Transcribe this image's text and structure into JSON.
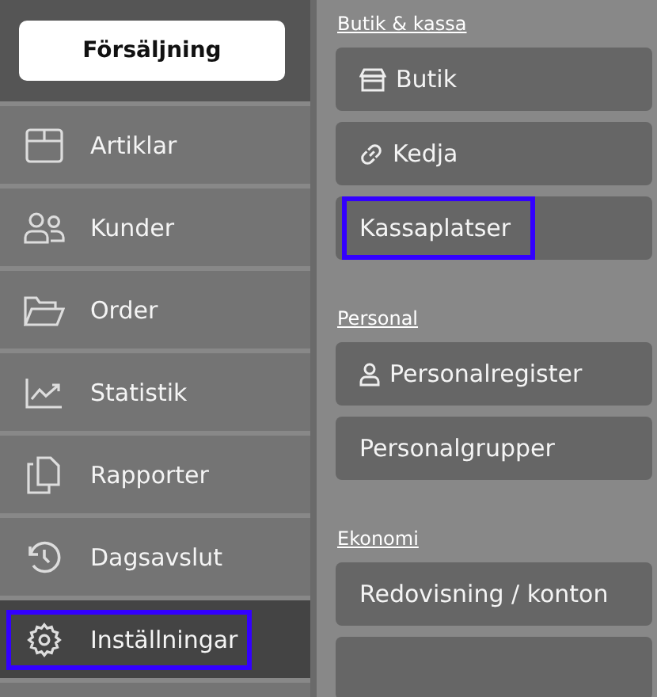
{
  "sales_button": {
    "label": "Försäljning"
  },
  "nav": [
    {
      "label": "Artiklar",
      "kind": "box",
      "selected": false,
      "highlighted": false
    },
    {
      "label": "Kunder",
      "kind": "users",
      "selected": false,
      "highlighted": false
    },
    {
      "label": "Order",
      "kind": "folder",
      "selected": false,
      "highlighted": false
    },
    {
      "label": "Statistik",
      "kind": "chart",
      "selected": false,
      "highlighted": false
    },
    {
      "label": "Rapporter",
      "kind": "copy",
      "selected": false,
      "highlighted": false
    },
    {
      "label": "Dagsavslut",
      "kind": "history",
      "selected": false,
      "highlighted": false
    },
    {
      "label": "Inställningar",
      "kind": "gear",
      "selected": true,
      "highlighted": true
    }
  ],
  "sections": [
    {
      "heading": "Butik & kassa",
      "items": [
        {
          "label": "Butik",
          "kind": "store",
          "highlighted": false
        },
        {
          "label": "Kedja",
          "kind": "link",
          "highlighted": false
        },
        {
          "label": "Kassaplatser",
          "kind": "plain",
          "highlighted": true
        }
      ]
    },
    {
      "heading": "Personal",
      "items": [
        {
          "label": "Personalregister",
          "kind": "person",
          "highlighted": false
        },
        {
          "label": "Personalgrupper",
          "kind": "plain",
          "highlighted": false
        }
      ]
    },
    {
      "heading": "Ekonomi",
      "items": [
        {
          "label": "Redovisning / konton",
          "kind": "plain",
          "highlighted": false
        },
        {
          "kind": "plain",
          "highlighted": false
        }
      ]
    }
  ]
}
